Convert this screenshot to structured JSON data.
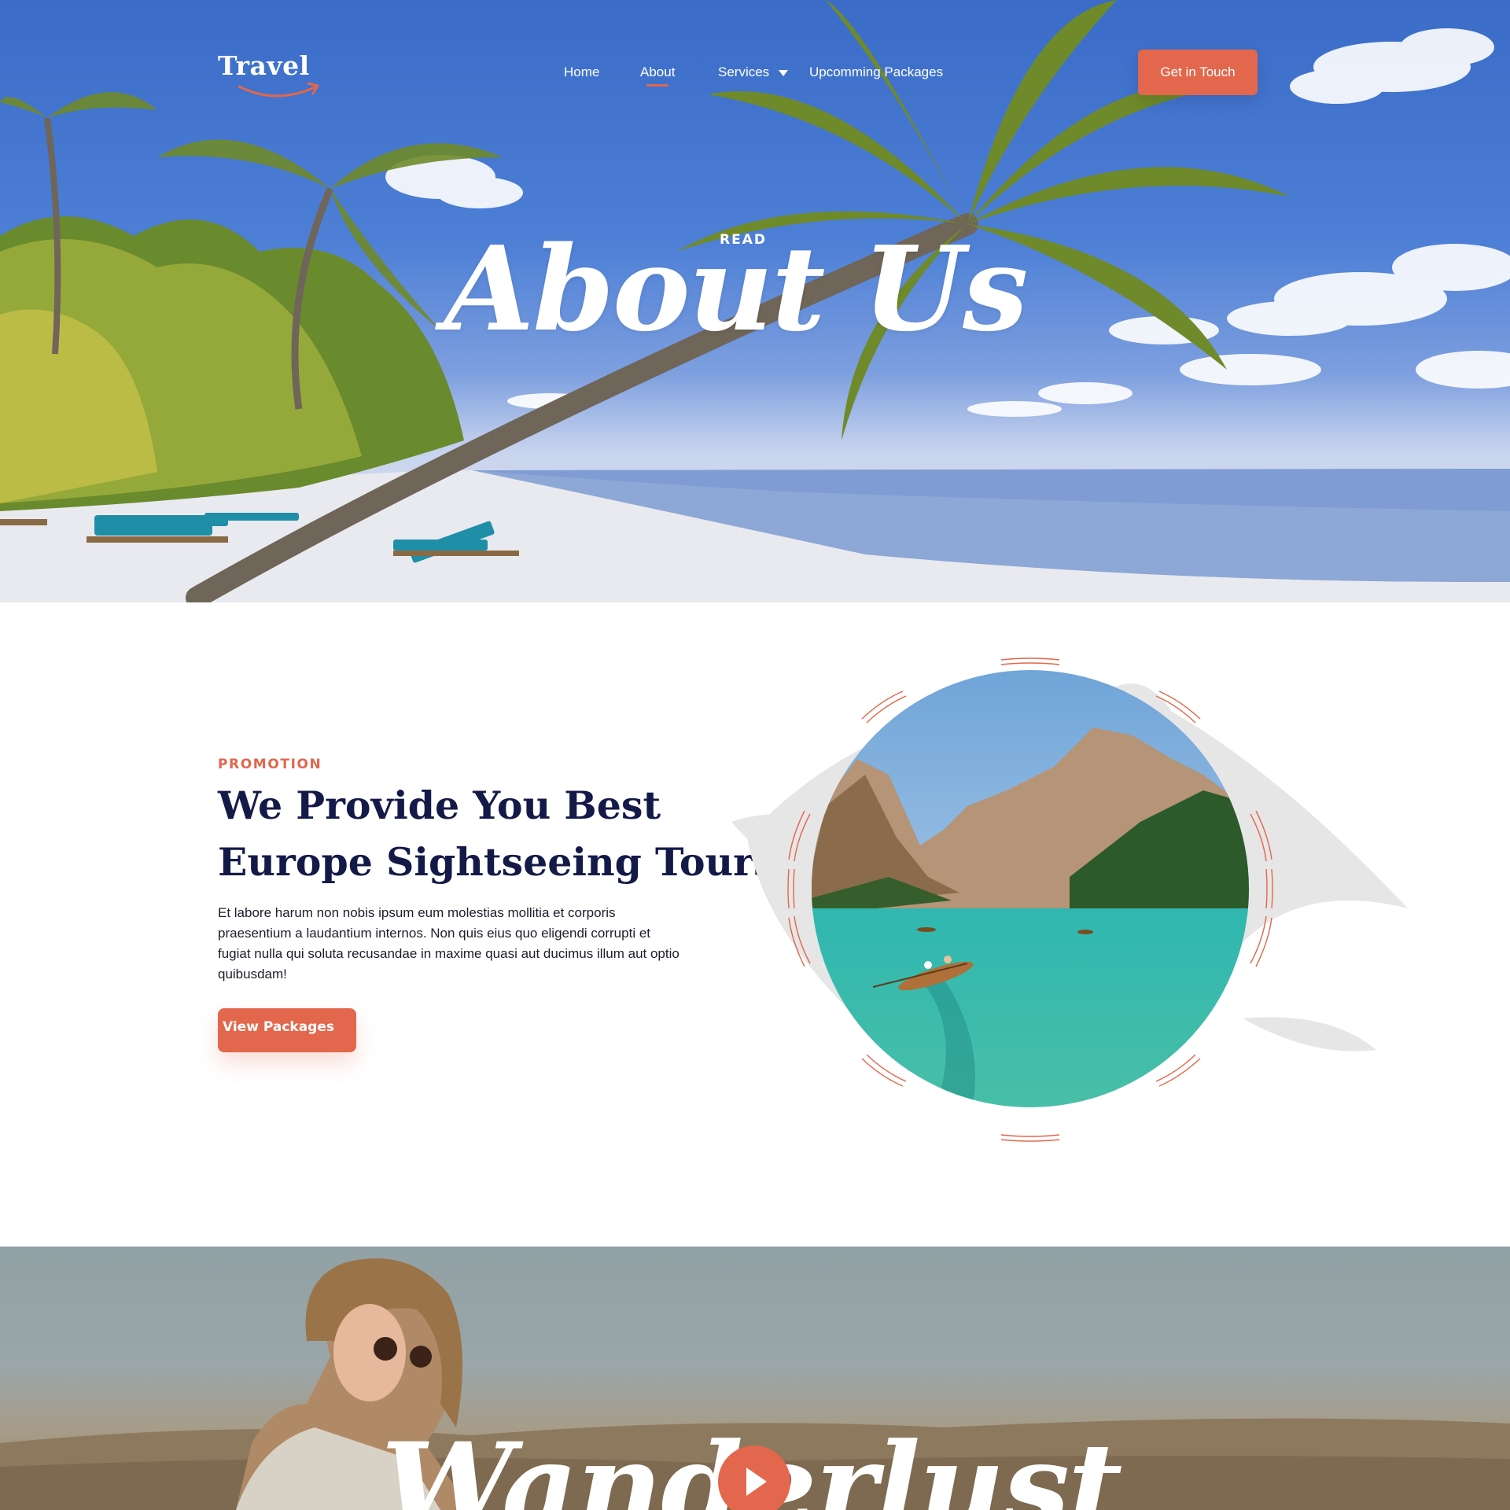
{
  "brand": {
    "name": "Travel",
    "accent_color": "#e2674c",
    "heading_color": "#131a48"
  },
  "nav": {
    "items": [
      {
        "label": "Home",
        "active": false
      },
      {
        "label": "About",
        "active": true
      },
      {
        "label": "Services",
        "active": false,
        "has_dropdown": true
      },
      {
        "label": "Upcomming Packages",
        "active": false
      }
    ],
    "cta_label": "Get in Touch"
  },
  "hero": {
    "kicker": "READ",
    "title": "About Us"
  },
  "promo": {
    "kicker": "PROMOTION",
    "title_line_1": "We Provide You Best",
    "title_line_2": "Europe Sightseeing Tours",
    "body": "Et labore harum non nobis ipsum eum molestias mollitia et corporis praesentium a laudantium internos. Non quis eius quo eligendi corrupti et fugiat nulla qui soluta recusandae in maxime quasi aut ducimus illum aut optio quibusdam!",
    "button_label": "View Packages"
  },
  "video": {
    "title": "Wanderlust",
    "play_icon": "play-icon"
  }
}
